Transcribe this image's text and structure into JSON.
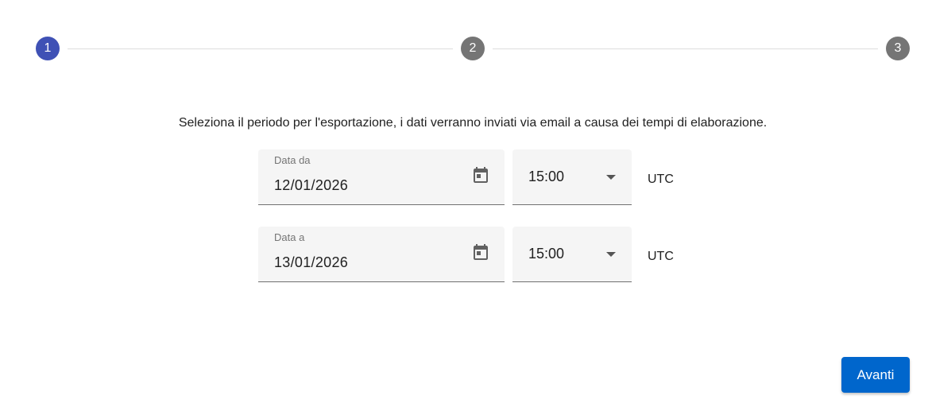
{
  "stepper": {
    "steps": [
      {
        "label": "1",
        "state": "active"
      },
      {
        "label": "2",
        "state": "inactive"
      },
      {
        "label": "3",
        "state": "inactive"
      }
    ],
    "active_color": "#3f51b5",
    "inactive_color": "#757575"
  },
  "instruction": "Seleziona il periodo per l'esportazione, i dati verranno inviati via email a causa dei tempi di elaborazione.",
  "from": {
    "label": "Data da",
    "date": "12/01/2026",
    "time": "15:00",
    "timezone": "UTC"
  },
  "to": {
    "label": "Data a",
    "date": "13/01/2026",
    "time": "15:00",
    "timezone": "UTC"
  },
  "icons": {
    "date_picker": "calendar-icon",
    "time_dropdown": "chevron-down-icon"
  },
  "next_button": {
    "label": "Avanti",
    "color": "#0066cc"
  }
}
